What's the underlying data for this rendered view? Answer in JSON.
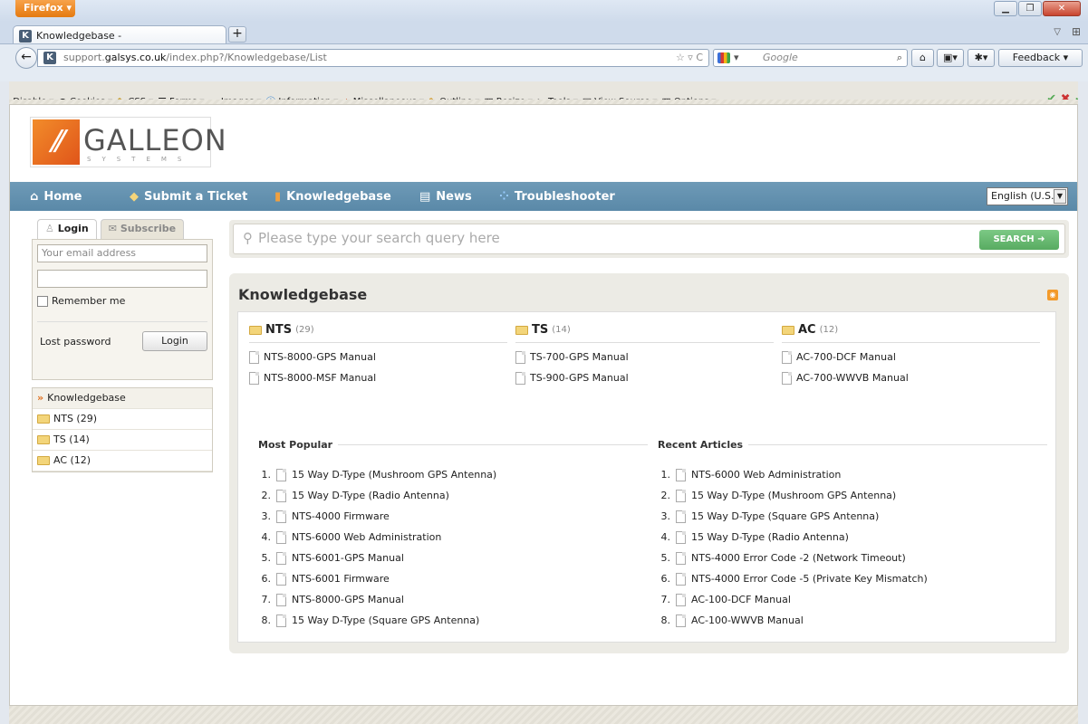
{
  "browser": {
    "app_button": "Firefox",
    "tab_title": "Knowledgebase -",
    "url_prefix": "support.",
    "url_domain": "galsys.co.uk",
    "url_path": "/index.php?/Knowledgebase/List",
    "search_engine": "Google",
    "feedback": "Feedback"
  },
  "webdev_toolbar": {
    "items": [
      "Disable",
      "Cookies",
      "CSS",
      "Forms",
      "Images",
      "Information",
      "Miscellaneous",
      "Outline",
      "Resize",
      "Tools",
      "View Source",
      "Options"
    ]
  },
  "site": {
    "logo_text": "GALLEON",
    "logo_sub": "SYSTEMS",
    "nav": [
      "Home",
      "Submit a Ticket",
      "Knowledgebase",
      "News",
      "Troubleshooter"
    ],
    "language": "English (U.S.)"
  },
  "sidebar": {
    "tab_login": "Login",
    "tab_subscribe": "Subscribe",
    "email_placeholder": "Your email address",
    "remember": "Remember me",
    "lost_password": "Lost password",
    "login_button": "Login",
    "categories_header": "Knowledgebase",
    "categories": [
      "NTS (29)",
      "TS (14)",
      "AC (12)"
    ]
  },
  "search": {
    "placeholder": "Please type your search query here",
    "button": "SEARCH"
  },
  "kb": {
    "title": "Knowledgebase",
    "categories": [
      {
        "name": "NTS",
        "count": "(29)",
        "articles": [
          "NTS-8000-GPS Manual",
          "NTS-8000-MSF Manual"
        ]
      },
      {
        "name": "TS",
        "count": "(14)",
        "articles": [
          "TS-700-GPS Manual",
          "TS-900-GPS Manual"
        ]
      },
      {
        "name": "AC",
        "count": "(12)",
        "articles": [
          "AC-700-DCF Manual",
          "AC-700-WWVB Manual"
        ]
      }
    ],
    "popular_title": "Most Popular",
    "popular": [
      "15 Way D-Type (Mushroom GPS Antenna)",
      "15 Way D-Type (Radio Antenna)",
      "NTS-4000 Firmware",
      "NTS-6000 Web Administration",
      "NTS-6001-GPS Manual",
      "NTS-6001 Firmware",
      "NTS-8000-GPS Manual",
      "15 Way D-Type (Square GPS Antenna)"
    ],
    "recent_title": "Recent Articles",
    "recent": [
      "NTS-6000 Web Administration",
      "15 Way D-Type (Mushroom GPS Antenna)",
      "15 Way D-Type (Square GPS Antenna)",
      "15 Way D-Type (Radio Antenna)",
      "NTS-4000 Error Code -2 (Network Timeout)",
      "NTS-4000 Error Code -5 (Private Key Mismatch)",
      "AC-100-DCF Manual",
      "AC-100-WWVB Manual"
    ]
  },
  "colors": {
    "nav_bg": "#5f8dac",
    "accent": "#e8862a",
    "search_btn": "#62b46b"
  }
}
